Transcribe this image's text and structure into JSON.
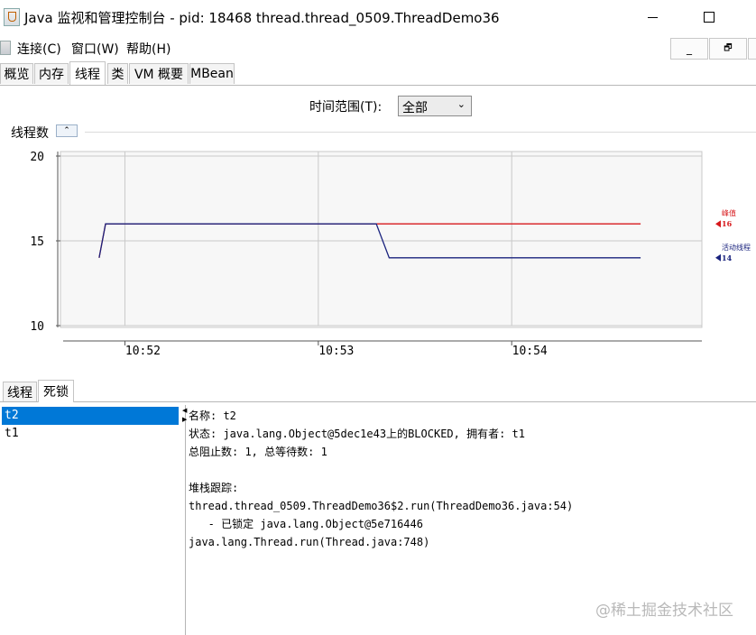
{
  "window": {
    "title": "Java 监视和管理控制台 - pid: 18468 thread.thread_0509.ThreadDemo36",
    "maximize_glyph": "☐"
  },
  "menu": {
    "items": [
      "连接(C)",
      "窗口(W)",
      "帮助(H)"
    ],
    "mdi_restore_glyph": "🗗"
  },
  "tabs": [
    "概览",
    "内存",
    "线程",
    "类",
    "VM 概要",
    "MBean"
  ],
  "active_tab": "线程",
  "time_range": {
    "label": "时间范围(T):",
    "value": "全部"
  },
  "chart_section": {
    "title": "线程数",
    "collapse_glyph": "⌃"
  },
  "chart_data": {
    "type": "line",
    "x": [
      "10:51:52",
      "10:51:54",
      "10:53:18",
      "10:53:22",
      "10:54:40"
    ],
    "xticks": [
      "10:52",
      "10:53",
      "10:54"
    ],
    "ylim": [
      10,
      20
    ],
    "yticks": [
      10,
      15,
      20
    ],
    "grid": true,
    "series": [
      {
        "name": "峰值",
        "color": "#d7191c",
        "values": [
          14,
          16,
          16,
          16,
          16
        ],
        "current": 16
      },
      {
        "name": "活动线程",
        "color": "#1a237e",
        "values": [
          14,
          16,
          16,
          14,
          14
        ],
        "current": 14
      }
    ]
  },
  "bottom_tabs": [
    "线程",
    "死锁"
  ],
  "active_bottom_tab": "死锁",
  "threads": [
    "t2",
    "t1"
  ],
  "selected_thread": "t2",
  "details": {
    "name_line": "名称: t2",
    "state_line": "状态: java.lang.Object@5dec1e43上的BLOCKED, 拥有者: t1",
    "counts_line": "总阻止数: 1, 总等待数: 1",
    "stack_header": "堆栈跟踪:",
    "stack": [
      "thread.thread_0509.ThreadDemo36$2.run(ThreadDemo36.java:54)",
      "   - 已锁定 java.lang.Object@5e716446",
      "java.lang.Thread.run(Thread.java:748)"
    ]
  },
  "watermark": "@稀土掘金技术社区"
}
